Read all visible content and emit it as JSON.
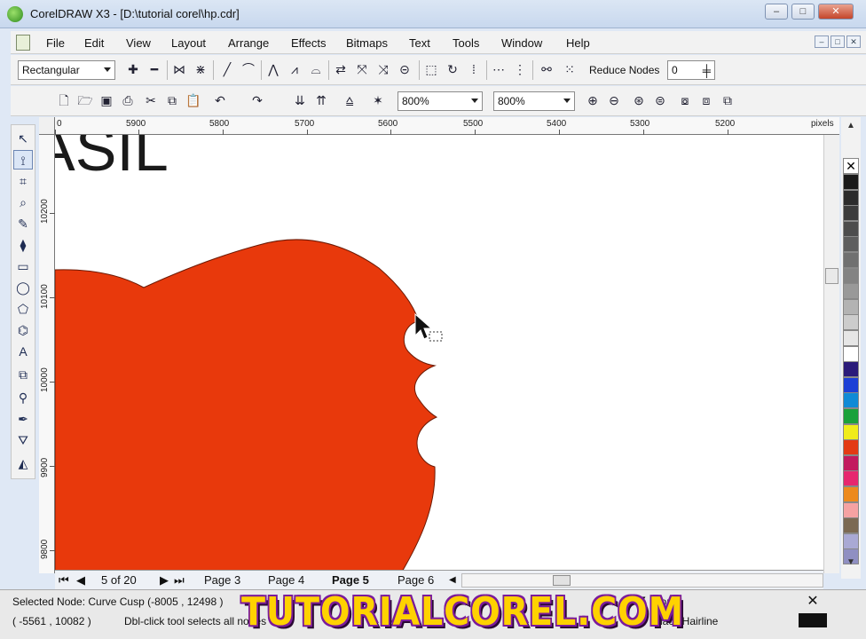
{
  "window": {
    "title": "CorelDRAW X3 - [D:\\tutorial corel\\hp.cdr]",
    "buttons": [
      "–",
      "□",
      "✕"
    ]
  },
  "menu": {
    "items": [
      "File",
      "Edit",
      "View",
      "Layout",
      "Arrange",
      "Effects",
      "Bitmaps",
      "Text",
      "Tools",
      "Window",
      "Help"
    ],
    "doc_buttons": [
      "–",
      "□",
      "✕"
    ]
  },
  "property_bar": {
    "selection_mode": "Rectangular",
    "reduce_nodes_label": "Reduce Nodes",
    "reduce_nodes_value": "0"
  },
  "standard_bar": {
    "zoom_a": "800%",
    "zoom_b": "800%"
  },
  "rulers": {
    "horizontal_labels": [
      "0",
      "5900",
      "5800",
      "5700",
      "5600",
      "5500",
      "5400",
      "5300",
      "5200"
    ],
    "horizontal_unit": "pixels",
    "vertical_labels": [
      "10200",
      "10100",
      "10000",
      "9900",
      "9800"
    ],
    "vertical_unit": "pixels"
  },
  "canvas": {
    "text_fragment": "ASIL",
    "shape_color": "#e8390c",
    "background_color": "#ffffff"
  },
  "palette": {
    "colors": [
      "#1a1a1a",
      "#2c2c2c",
      "#3c3c3c",
      "#4d4d4d",
      "#5e5e5e",
      "#707070",
      "#838383",
      "#999999",
      "#b3b3b3",
      "#cccccc",
      "#e6e6e6",
      "#ffffff",
      "#2a1b7a",
      "#1c3fd6",
      "#0f8ad6",
      "#1aa13a",
      "#f0ec1a",
      "#e33a14",
      "#c21a5f",
      "#e6276f",
      "#ed8a1e",
      "#f5a2a2",
      "#7b6952",
      "#a9a9d4",
      "#8f8fc2"
    ]
  },
  "pages": {
    "counter": "5 of 20",
    "tabs": [
      "Page 3",
      "Page 4",
      "Page 5",
      "Page 6"
    ],
    "active_tab": "Page 5"
  },
  "status": {
    "line1": "Selected Node: Curve Cusp (-8005 , 12498 )",
    "line2_coords": "( -5561 , 10082 )",
    "line2_hint": "Dbl-click tool selects all nodes",
    "fill_label": "None",
    "outline_label": "Black  Hairline",
    "watermark": "TUTORIALCOREL.COM"
  }
}
